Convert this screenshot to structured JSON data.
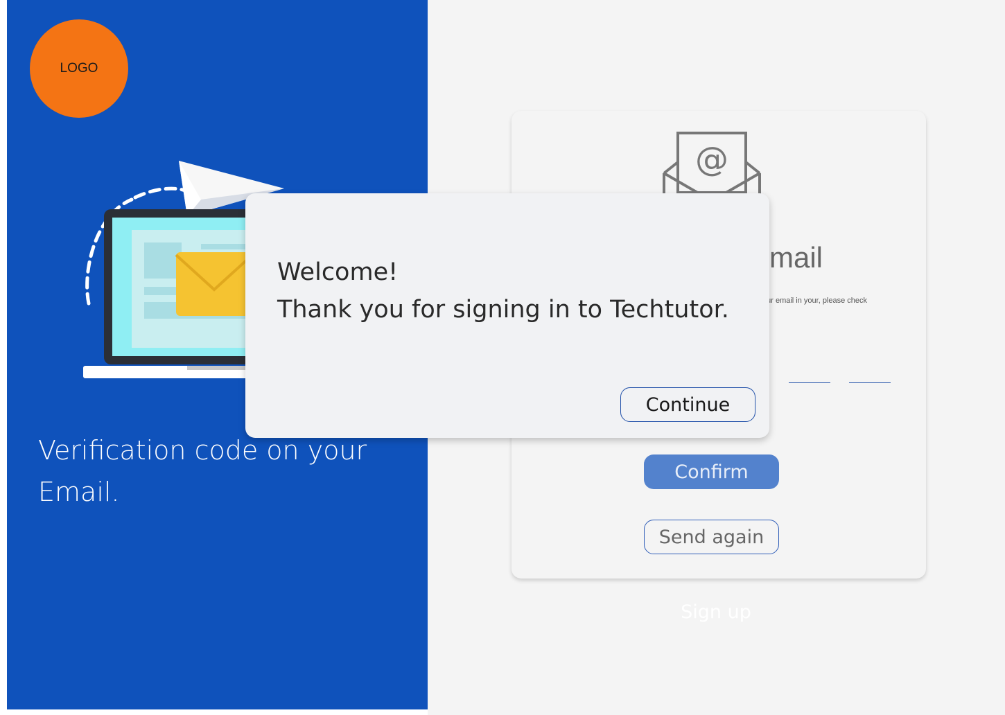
{
  "left": {
    "logo_text": "LOGO",
    "headline": "Verification code on your Email."
  },
  "card": {
    "title": "mail",
    "subtitle": "our email in your, please check",
    "confirm_label": "Confirm",
    "send_again_label": "Send again",
    "signup_label": "Sign up"
  },
  "modal": {
    "line1": "Welcome!",
    "line2": "Thank you for signing in to Techtutor.",
    "continue_label": "Continue"
  },
  "colors": {
    "left_panel": "#0f52bb",
    "logo": "#f47414",
    "confirm_button": "#5382cd",
    "right_bg": "#f4f4f4"
  },
  "icons": [
    "envelope-at-icon",
    "laptop-mail-illustration",
    "paper-plane-icon"
  ]
}
